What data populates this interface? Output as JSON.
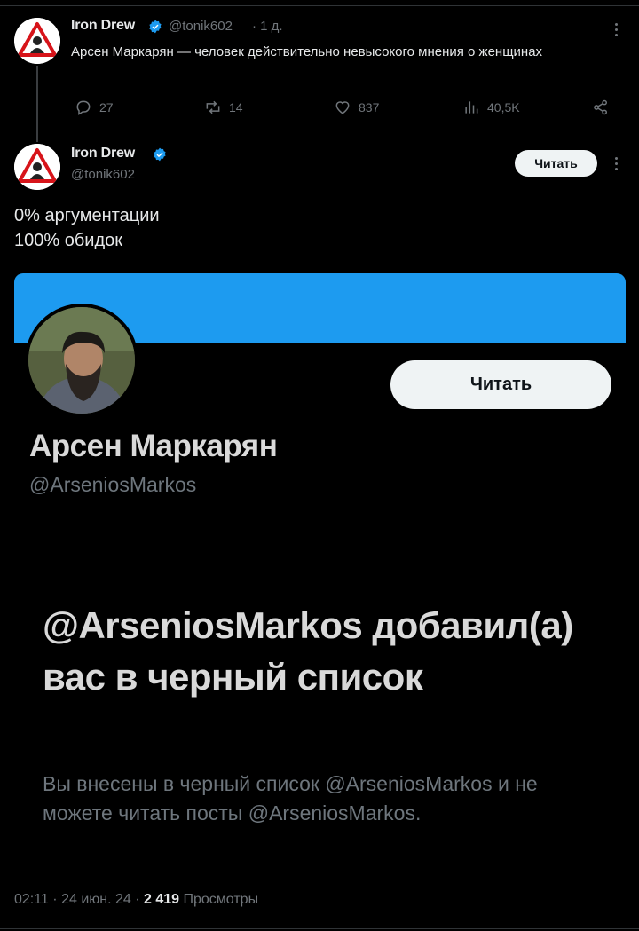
{
  "reply": {
    "author_name": "Iron Drew",
    "author_handle": "@tonik602",
    "age": "· 1 д.",
    "text": "Арсен Маркарян — человек действительно невысокого мнения о женщинах",
    "actions": {
      "replies": "27",
      "reposts": "14",
      "likes": "837",
      "views": "40,5K"
    }
  },
  "main_tweet": {
    "author_name": "Iron Drew",
    "author_handle": "@tonik602",
    "follow_label": "Читать",
    "text_line1": "0% аргументации",
    "text_line2": "100% обидок"
  },
  "attached_screenshot": {
    "profile_name": "Арсен Маркарян",
    "profile_handle": "@ArseniosMarkos",
    "follow_label": "Читать",
    "block_title": "@ArseniosMarkos добавил(а) вас в черный список",
    "block_description": "Вы внесены в черный список @ArseniosMarkos и не можете читать посты @ArseniosMarkos.",
    "banner_color": "#1d9bf0"
  },
  "meta": {
    "time": "02:11 · 24 июн. 24 · ",
    "views_count": "2 419",
    "views_label": " Просмотры"
  },
  "colors": {
    "background": "#000000",
    "muted": "#71767b",
    "verified": "#1d9bf0"
  },
  "icons": [
    "warning-logo-icon",
    "verified-badge-icon",
    "more-icon",
    "reply-icon",
    "repost-icon",
    "like-icon",
    "views-icon",
    "share-icon"
  ]
}
